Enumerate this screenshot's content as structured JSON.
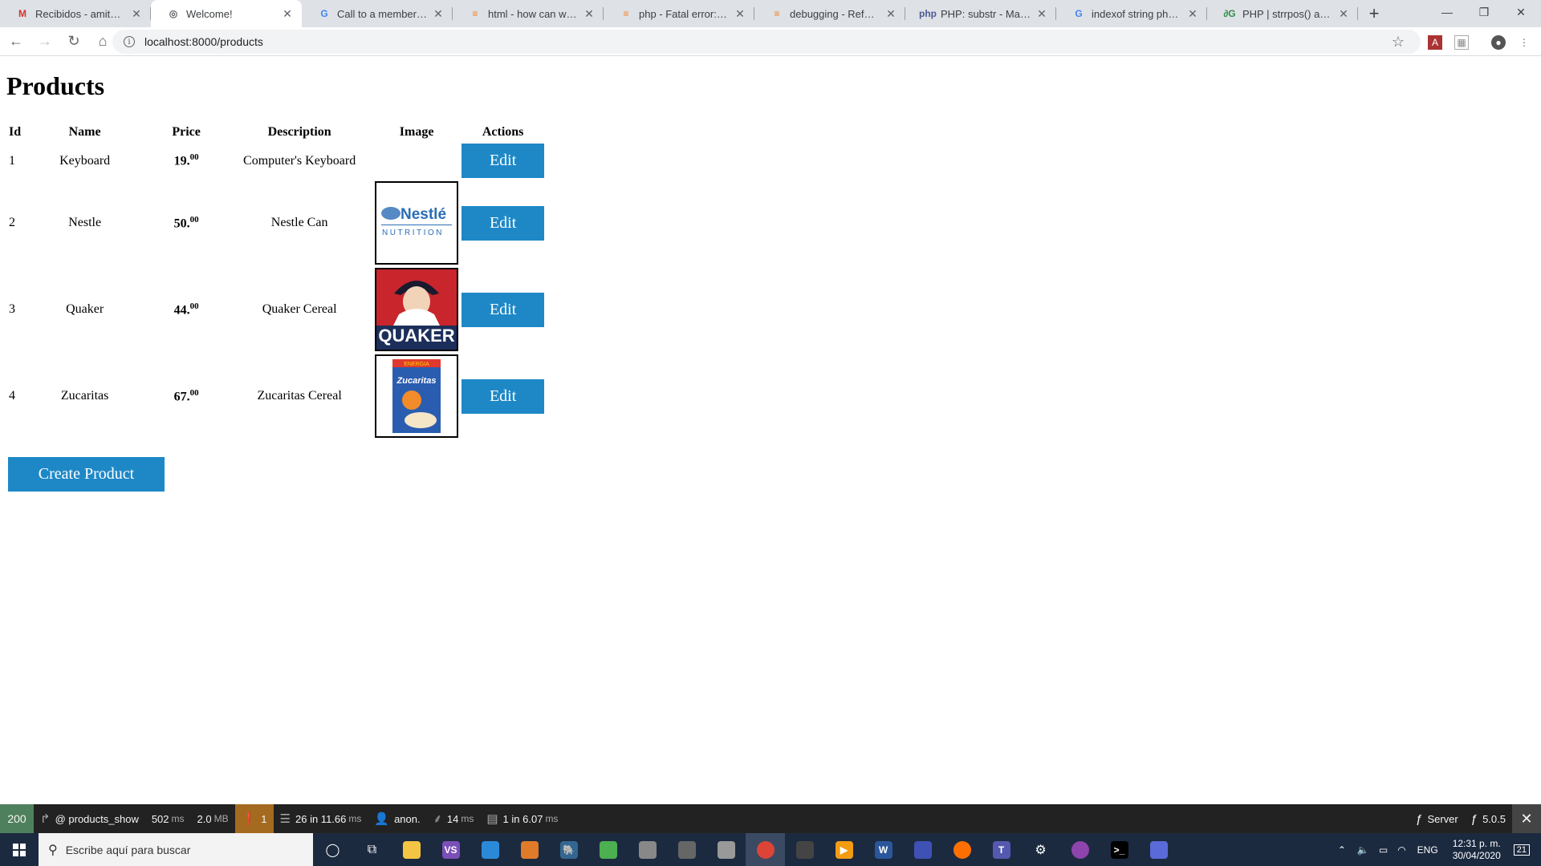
{
  "browser": {
    "tabs": [
      {
        "title": "Recibidos - amitaypb@",
        "favicon": "gmail-icon",
        "glyph": "M",
        "color": "#d93025"
      },
      {
        "title": "Welcome!",
        "favicon": "globe-icon",
        "glyph": "◎",
        "color": "#5f6368"
      },
      {
        "title": "Call to a member functi",
        "favicon": "google-icon",
        "glyph": "G",
        "color": "#4285f4"
      },
      {
        "title": "html - how can we mak",
        "favicon": "stackoverflow-icon",
        "glyph": "≡",
        "color": "#f48024"
      },
      {
        "title": "php - Fatal error: Call to",
        "favicon": "stackoverflow-icon",
        "glyph": "≡",
        "color": "#f48024"
      },
      {
        "title": "debugging - Reference",
        "favicon": "stackoverflow-icon",
        "glyph": "≡",
        "color": "#f48024"
      },
      {
        "title": "PHP: substr - Manual",
        "favicon": "php-icon",
        "glyph": "php",
        "color": "#4f5b93"
      },
      {
        "title": "indexof string php - Bu",
        "favicon": "google-icon",
        "glyph": "G",
        "color": "#4285f4"
      },
      {
        "title": "PHP | strrpos() and strr",
        "favicon": "geeksforgeeks-icon",
        "glyph": "∂G",
        "color": "#2f8d46"
      }
    ],
    "url": "localhost:8000/products"
  },
  "page": {
    "title": "Products",
    "columns": [
      "Id",
      "Name",
      "Price",
      "Description",
      "Image",
      "Actions"
    ],
    "products": [
      {
        "id": "1",
        "name": "Keyboard",
        "price_int": "19.",
        "price_dec": "00",
        "description": "Computer's Keyboard",
        "image": "",
        "edit": "Edit"
      },
      {
        "id": "2",
        "name": "Nestle",
        "price_int": "50.",
        "price_dec": "00",
        "description": "Nestle Can",
        "image": "Nestlé NUTRITION",
        "edit": "Edit"
      },
      {
        "id": "3",
        "name": "Quaker",
        "price_int": "44.",
        "price_dec": "00",
        "description": "Quaker Cereal",
        "image": "QUAKER",
        "edit": "Edit"
      },
      {
        "id": "4",
        "name": "Zucaritas",
        "price_int": "67.",
        "price_dec": "00",
        "description": "Zucaritas Cereal",
        "image": "ZUCARITAS",
        "edit": "Edit"
      }
    ],
    "create_label": "Create Product"
  },
  "debug_toolbar": {
    "status": "200",
    "route": "@ products_show",
    "time": "502",
    "time_unit": "ms",
    "memory": "2.0",
    "memory_unit": "MB",
    "warnings": "1",
    "queries": "26",
    "queries_time": "in 11.66",
    "queries_unit": "ms",
    "user": "anon.",
    "render": "14",
    "render_unit": "ms",
    "cache": "1",
    "cache_time": "in 6.07",
    "cache_unit": "ms",
    "server": "Server",
    "version": "5.0.5"
  },
  "taskbar": {
    "search_placeholder": "Escribe aquí para buscar",
    "lang": "ENG",
    "time": "12:31 p. m.",
    "date": "30/04/2020",
    "notifications": "21"
  }
}
